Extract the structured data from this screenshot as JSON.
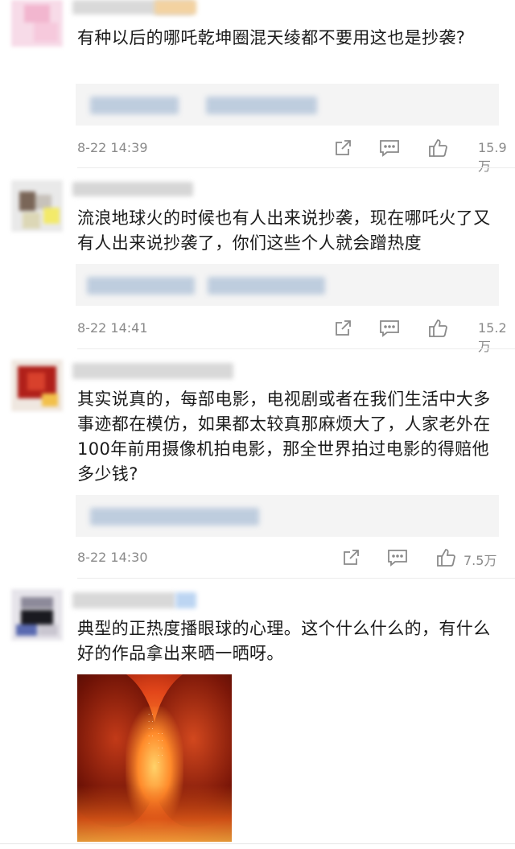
{
  "comments": [
    {
      "text": "有种以后的哪吒乾坤圈混天绫都不要用这也是抄袭?",
      "time": "8-22 14:39",
      "likes": "15.9万"
    },
    {
      "text": "流浪地球火的时候也有人出来说抄袭，现在哪吒火了又有人出来说抄袭了，你们这些个人就会蹭热度",
      "time": "8-22 14:41",
      "likes": "15.2万"
    },
    {
      "text": "其实说真的，每部电影，电视剧或者在我们生活中大多事迹都在模仿，如果都太较真那麻烦大了，人家老外在100年前用摄像机拍电影，那全世界拍过电影的得赔他多少钱?",
      "time": "8-22 14:30",
      "likes": "7.5万"
    },
    {
      "text": "典型的正热度播眼球的心理。这个什么什么的，有什么好的作品拿出来晒一晒呀。"
    }
  ],
  "icons": {
    "share": "share-icon",
    "comment": "comment-icon",
    "like": "thumbs-up-icon"
  },
  "colors": {
    "meta_text": "#8a8a8a",
    "reply_bg": "#f4f4f4",
    "blurred_link": "#b9c9dc"
  }
}
